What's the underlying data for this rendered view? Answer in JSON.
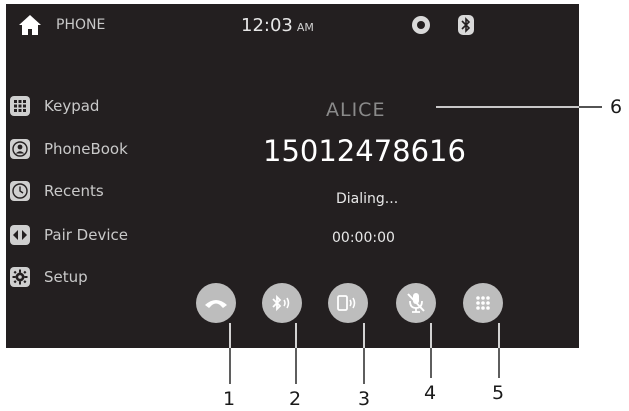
{
  "header": {
    "title": "PHONE",
    "time": "12:03",
    "ampm": "AM",
    "icons": [
      "home-icon",
      "settings-circle-icon",
      "bluetooth-icon"
    ]
  },
  "sidebar": {
    "items": [
      {
        "label": "Keypad",
        "icon": "keypad-icon"
      },
      {
        "label": "PhoneBook",
        "icon": "phonebook-icon"
      },
      {
        "label": "Recents",
        "icon": "clock-icon"
      },
      {
        "label": "Pair Device",
        "icon": "pair-device-icon"
      },
      {
        "label": "Setup",
        "icon": "gear-icon"
      }
    ]
  },
  "call": {
    "caller_name": "ALICE",
    "number": "15012478616",
    "status": "Dialing...",
    "duration": "00:00:00"
  },
  "controls": [
    {
      "icon": "hang-up-icon"
    },
    {
      "icon": "bluetooth-audio-icon"
    },
    {
      "icon": "phone-audio-icon"
    },
    {
      "icon": "mic-mute-icon"
    },
    {
      "icon": "keypad-icon"
    }
  ],
  "callouts": {
    "c1": "1",
    "c2": "2",
    "c3": "3",
    "c4": "4",
    "c5": "5",
    "c6": "6"
  },
  "colors": {
    "screen_bg": "#231f20",
    "button_bg": "#bdbdbd",
    "text_primary": "#ffffff",
    "text_secondary": "#c9c9c9"
  }
}
